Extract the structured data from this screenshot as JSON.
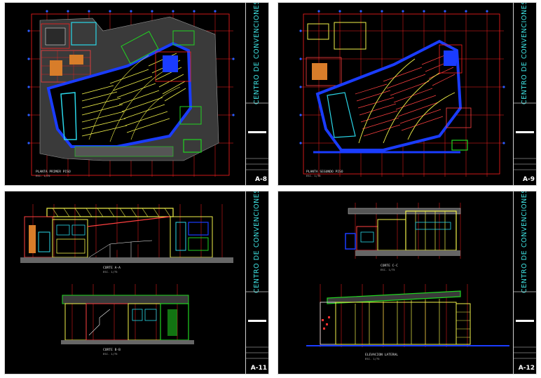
{
  "project_title": "CENTRO DE CONVENCIONES",
  "sheets": [
    {
      "id": "sheet-1",
      "number": "A-8",
      "views": [
        {
          "title": "PLANTA PRIMER PISO",
          "scale": "ESC. 1/75"
        }
      ]
    },
    {
      "id": "sheet-2",
      "number": "A-9",
      "views": [
        {
          "title": "PLANTA SEGUNDO PISO",
          "scale": "ESC. 1/75"
        }
      ]
    },
    {
      "id": "sheet-3",
      "number": "A-11",
      "views": [
        {
          "title": "CORTE A-A",
          "scale": "ESC. 1/75"
        },
        {
          "title": "CORTE B-B",
          "scale": "ESC. 1/75"
        }
      ]
    },
    {
      "id": "sheet-4",
      "number": "A-12",
      "views": [
        {
          "title": "CORTE C-C",
          "scale": "ESC. 1/75"
        },
        {
          "title": "ELEVACION LATERAL",
          "scale": "ESC. 1/75"
        }
      ]
    }
  ],
  "colors": {
    "background": "#000000",
    "frame": "#d8d8d8",
    "grid": "#ff2020",
    "wall": "#1a3cff",
    "seating": "#f2f24a",
    "glazing": "#2ad6e8",
    "landscape": "#21d421",
    "title_text": "#3ee0e0"
  }
}
